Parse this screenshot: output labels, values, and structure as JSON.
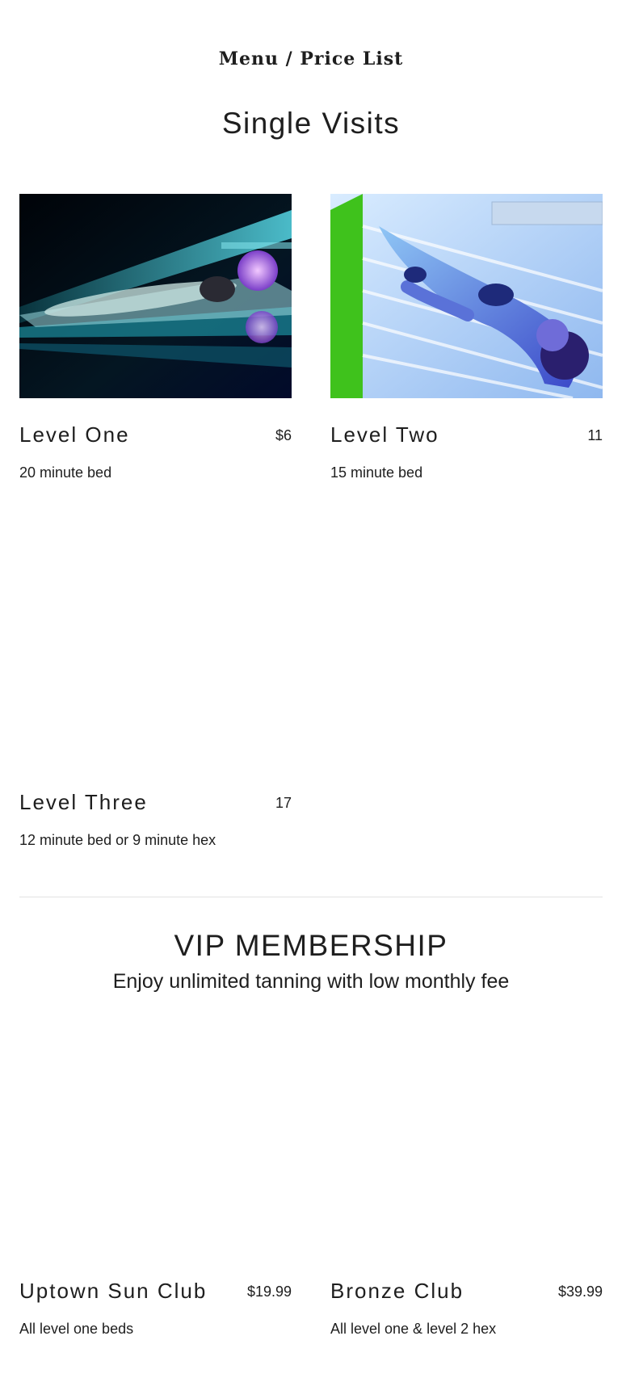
{
  "page": {
    "heading": "Menu / Price List"
  },
  "single_visits": {
    "title": "Single Visits",
    "items": [
      {
        "name": "Level One",
        "price": "$6",
        "description": "20 minute bed",
        "image": "tanning-bed-photo-dark-cyan"
      },
      {
        "name": "Level Two",
        "price": "11",
        "description": "15 minute bed",
        "image": "tanning-bed-photo-blue"
      },
      {
        "name": "Level Three",
        "price": "17",
        "description": "12 minute bed or 9 minute hex"
      }
    ]
  },
  "vip": {
    "title": "VIP MEMBERSHIP",
    "subtitle": "Enjoy unlimited tanning with low monthly fee",
    "items": [
      {
        "name": "Uptown Sun Club",
        "price": "$19.99",
        "description": "All level one beds"
      },
      {
        "name": "Bronze Club",
        "price": "$39.99",
        "description": "All level one & level 2 hex"
      }
    ]
  },
  "colors": {
    "text": "#1e1e1e",
    "divider": "#e2e2e2",
    "photo_one_accent": "#2fb7c9",
    "photo_two_accent": "#3a6cf0"
  }
}
